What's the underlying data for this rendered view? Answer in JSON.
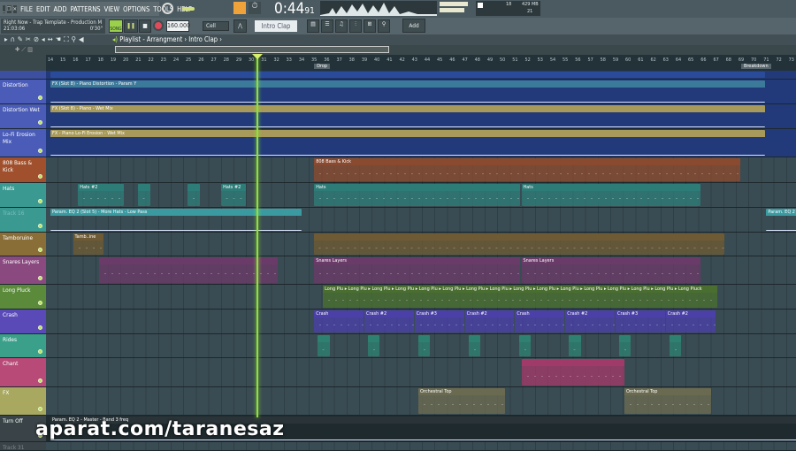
{
  "menu": {
    "items": [
      "FILE",
      "EDIT",
      "ADD",
      "PATTERNS",
      "VIEW",
      "OPTIONS",
      "TOOLS",
      "HELP"
    ]
  },
  "project": {
    "title": "Right Now - Trap Template - Production M",
    "time": "21:03:06",
    "length": "0'30\""
  },
  "transport": {
    "mode": "SONG",
    "tempo": "160.000",
    "snap": "Cell",
    "time_main": "0:44",
    "time_sub": "91",
    "cpu": "18",
    "memory": "429 MB",
    "polyphony": "21"
  },
  "pattern": {
    "name": "Intro Clap",
    "add_label": "Add"
  },
  "breadcrumb": {
    "items": [
      "Playlist",
      "Arrangment",
      "Intro Clap"
    ]
  },
  "ruler": {
    "first_bar": 14,
    "last_bar": 73,
    "markers": [
      {
        "label": "Drop",
        "bar": 35
      },
      {
        "label": "Breakdown",
        "bar": 69
      }
    ]
  },
  "playhead_bar": 30.4,
  "tracks": [
    {
      "name": "",
      "color": "#3c4fa0",
      "lane": "#223a7a",
      "h": 10,
      "clips": [
        {
          "start": 14,
          "end": 71,
          "label": "",
          "color": "#2a4a9a",
          "auto": true
        }
      ]
    },
    {
      "name": "Distortion",
      "color": "#4a5cb8",
      "lane": "#223a7a",
      "h": 28,
      "clips": [
        {
          "start": 14,
          "end": 71,
          "label": "FX (Slot 8) - Piano Distortion - Param Y",
          "color": "#3c7a9a",
          "auto": true
        }
      ]
    },
    {
      "name": "Distortion Wet",
      "color": "#4a5cb8",
      "lane": "#223a7a",
      "h": 28,
      "clips": [
        {
          "start": 14,
          "end": 71,
          "label": "FX (Slot 8) - Piano - Wet Mix",
          "color": "#a89a5a",
          "auto": true
        }
      ]
    },
    {
      "name": "Lo-Fi Erosion Mix",
      "color": "#4a5cb8",
      "lane": "#223a7a",
      "h": 32,
      "clips": [
        {
          "start": 14,
          "end": 71,
          "label": "FX - Piano Lo-Fi Erosion - Wet Mix",
          "color": "#a89a5a",
          "auto": true
        }
      ]
    },
    {
      "name": "808 Bass & Kick",
      "color": "#a0502c",
      "h": 29,
      "clips": [
        {
          "start": 35,
          "end": 69,
          "label": "808 Bass & Kick",
          "color": "#8a4a30"
        }
      ]
    },
    {
      "name": "Hats",
      "color": "#3a9a92",
      "h": 28,
      "clips": [
        {
          "start": 16.2,
          "end": 19.9,
          "label": "Hats #2",
          "color": "#2e7c78"
        },
        {
          "start": 21,
          "end": 22,
          "label": "",
          "color": "#2e7c78"
        },
        {
          "start": 24.9,
          "end": 26,
          "label": "",
          "color": "#2e7c78"
        },
        {
          "start": 27.6,
          "end": 29.6,
          "label": "Hats #2",
          "color": "#2e7c78"
        },
        {
          "start": 35,
          "end": 51.5,
          "label": "Hats",
          "color": "#2e7c78"
        },
        {
          "start": 51.5,
          "end": 65.8,
          "label": "Hats",
          "color": "#2e7c78"
        }
      ]
    },
    {
      "name": "Track 16",
      "color": "#3a9a92",
      "h": 28,
      "dim": true,
      "clips": [
        {
          "start": 14,
          "end": 34.1,
          "label": "Param. EQ 2 (Slot 5) - More Hats - Low Pass",
          "color": "#3a9aa0",
          "auto": true
        },
        {
          "start": 71,
          "end": 73.5,
          "label": "Param. EQ 2",
          "color": "#3a9aa0",
          "auto": true
        }
      ]
    },
    {
      "name": "Tamboruine",
      "color": "#8a6e38",
      "h": 27,
      "clips": [
        {
          "start": 15.8,
          "end": 18.3,
          "label": "Tamb..ine",
          "color": "#6e5a34"
        },
        {
          "start": 35,
          "end": 67.7,
          "label": "",
          "color": "#6e5a34"
        }
      ]
    },
    {
      "name": "Snares Layers",
      "color": "#8a4a80",
      "h": 32,
      "clips": [
        {
          "start": 17.9,
          "end": 32.2,
          "label": "",
          "color": "#6a3a68"
        },
        {
          "start": 35,
          "end": 51.5,
          "label": "Snares Layers",
          "color": "#6a3a68"
        },
        {
          "start": 51.5,
          "end": 65.8,
          "label": "Snares Layers",
          "color": "#6a3a68"
        }
      ]
    },
    {
      "name": "Long Pluck",
      "color": "#5a8a3a",
      "h": 28,
      "clips": [
        {
          "start": 35.7,
          "end": 67.2,
          "label": "Long Plu ▸ Long Plu ▸ Long Plu ▸ Long Plu ▸ Long Plu ▸ Long Plu ▸ Long Plu ▸ Long Plu ▸ Long Plu ▸ Long Plu ▸ Long Plu ▸ Long Plu ▸ Long Plu ▸ Long Plu ▸ Long Plu ▸ Long Pluck",
          "color": "#4a6e30"
        }
      ]
    },
    {
      "name": "Crash",
      "color": "#5a4ab8",
      "h": 28,
      "clips": [
        {
          "start": 35,
          "end": 39,
          "label": "Crash",
          "color": "#4a40a8"
        },
        {
          "start": 39,
          "end": 43,
          "label": "Crash #2",
          "color": "#4a40a8"
        },
        {
          "start": 43,
          "end": 47,
          "label": "Crash #3",
          "color": "#4a40a8"
        },
        {
          "start": 47,
          "end": 51,
          "label": "Crash #2",
          "color": "#4a40a8"
        },
        {
          "start": 51,
          "end": 55,
          "label": "Crash",
          "color": "#4a40a8"
        },
        {
          "start": 55,
          "end": 59,
          "label": "Crash #2",
          "color": "#4a40a8"
        },
        {
          "start": 59,
          "end": 63,
          "label": "Crash #3",
          "color": "#4a40a8"
        },
        {
          "start": 63,
          "end": 67,
          "label": "Crash #2",
          "color": "#4a40a8"
        }
      ]
    },
    {
      "name": "Rides",
      "color": "#3aa08a",
      "h": 27,
      "clips": [
        {
          "start": 35.3,
          "end": 36.3,
          "label": "",
          "color": "#2e8070"
        },
        {
          "start": 39.3,
          "end": 40.3,
          "label": "",
          "color": "#2e8070"
        },
        {
          "start": 43.3,
          "end": 44.3,
          "label": "",
          "color": "#2e8070"
        },
        {
          "start": 47.3,
          "end": 48.3,
          "label": "",
          "color": "#2e8070"
        },
        {
          "start": 51.3,
          "end": 52.3,
          "label": "",
          "color": "#2e8070"
        },
        {
          "start": 55.3,
          "end": 56.3,
          "label": "",
          "color": "#2e8070"
        },
        {
          "start": 59.3,
          "end": 60.3,
          "label": "",
          "color": "#2e8070"
        },
        {
          "start": 63.3,
          "end": 64.3,
          "label": "",
          "color": "#2e8070"
        }
      ]
    },
    {
      "name": "Chant",
      "color": "#b84a78",
      "h": 33,
      "clips": [
        {
          "start": 51.5,
          "end": 59.8,
          "label": "",
          "color": "#a03a68"
        }
      ]
    },
    {
      "name": "FX",
      "color": "#a8a860",
      "h": 32,
      "clips": [
        {
          "start": 43.3,
          "end": 50.3,
          "label": "Orchestral Top",
          "color": "#6a6a50"
        },
        {
          "start": 59.7,
          "end": 66.7,
          "label": "Orchestral Top",
          "color": "#6a6a50"
        }
      ]
    },
    {
      "name": "Turn Off",
      "color": "#3a4448",
      "lane": "#1e2a2e",
      "h": 30,
      "clips": [
        {
          "start": 14,
          "end": 74,
          "label": "Param. EQ 2 - Master - Band 3 freq",
          "color": "#2a3438",
          "auto": true
        }
      ]
    },
    {
      "name": "Track 31",
      "color": "#3a4448",
      "h": 10,
      "dim": true,
      "clips": []
    }
  ],
  "watermark": "aparat.com/taranesaz"
}
